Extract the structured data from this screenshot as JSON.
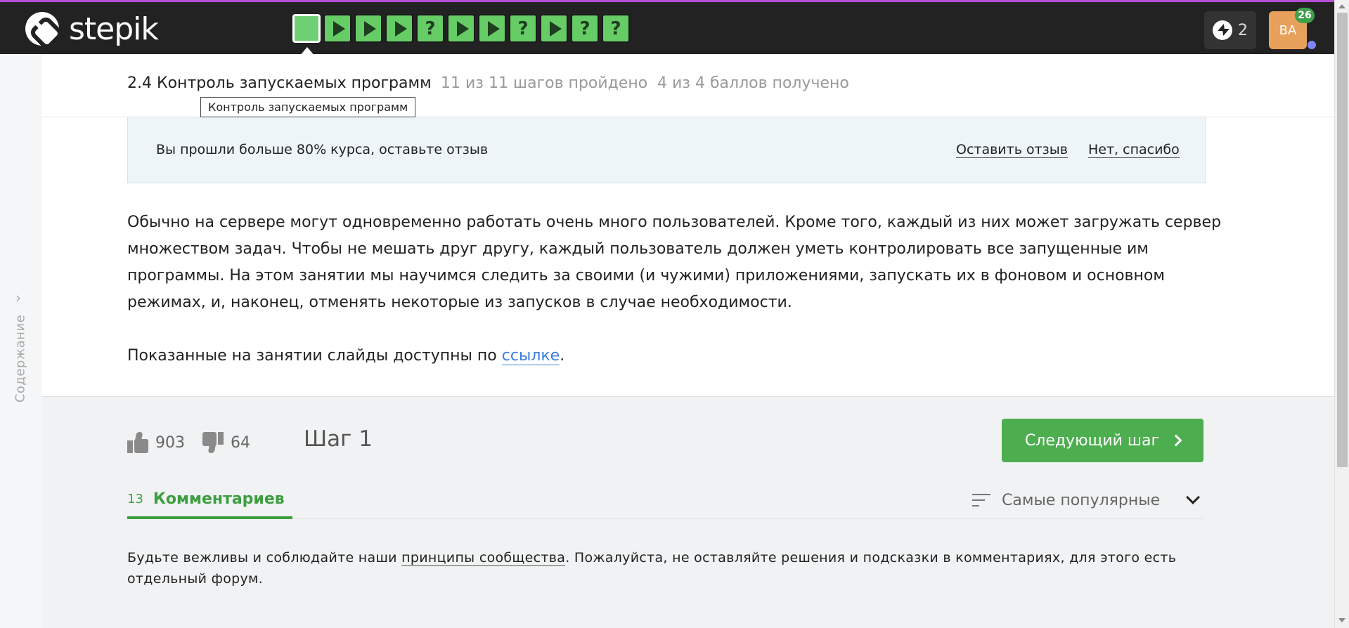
{
  "app": {
    "logo_text": "stepik",
    "energy_count": "2",
    "avatar_initials": "BA",
    "notifications_count": "26",
    "accent_color": "#b54fd6",
    "step_color": "#66cc66",
    "steps": [
      {
        "type": "text",
        "state": "active"
      },
      {
        "type": "video"
      },
      {
        "type": "video"
      },
      {
        "type": "video"
      },
      {
        "type": "quiz",
        "label": "?"
      },
      {
        "type": "video"
      },
      {
        "type": "video"
      },
      {
        "type": "quiz",
        "label": "?"
      },
      {
        "type": "video"
      },
      {
        "type": "quiz",
        "label": "?"
      },
      {
        "type": "quiz",
        "label": "?"
      }
    ]
  },
  "sidebar": {
    "toc_label": "Содержание",
    "toc_arrow": "›"
  },
  "lesson": {
    "title": "2.4 Контроль запускаемых программ",
    "progress": "11 из 11 шагов пройдено",
    "score": "4 из 4 баллов  получено",
    "tooltip": "Контроль запускаемых программ"
  },
  "review": {
    "text": "Вы прошли больше 80% курса, оставьте отзыв",
    "leave_label": "Оставить отзыв",
    "no_label": "Нет, спасибо"
  },
  "content": {
    "paragraph1": "Обычно на сервере могут одновременно работать очень много пользователей. Кроме того, каждый из них может загружать сервер множеством задач. Чтобы не мешать друг другу, каждый пользователь должен уметь контролировать все запущенные им программы. На этом занятии мы научимся следить за своими (и чужими) приложениями, запускать их в фоновом и основном режимах, и, наконец, отменять некоторые из запусков в случае необходимости.",
    "paragraph2_prefix": "Показанные на занятии слайды доступны по ",
    "paragraph2_link": "ссылке",
    "paragraph2_suffix": "."
  },
  "footer": {
    "likes": "903",
    "dislikes": "64",
    "step_label": "Шаг 1",
    "next_label": "Следующий шаг",
    "comments_count": "13",
    "comments_label": "Комментариев",
    "sort_label": "Самые популярные",
    "rules_prefix": "Будьте вежливы и соблюдайте наши ",
    "rules_link": "принципы сообщества",
    "rules_suffix": ". Пожалуйста, не оставляйте решения и подсказки в комментариях, для этого есть отдельный форум."
  }
}
